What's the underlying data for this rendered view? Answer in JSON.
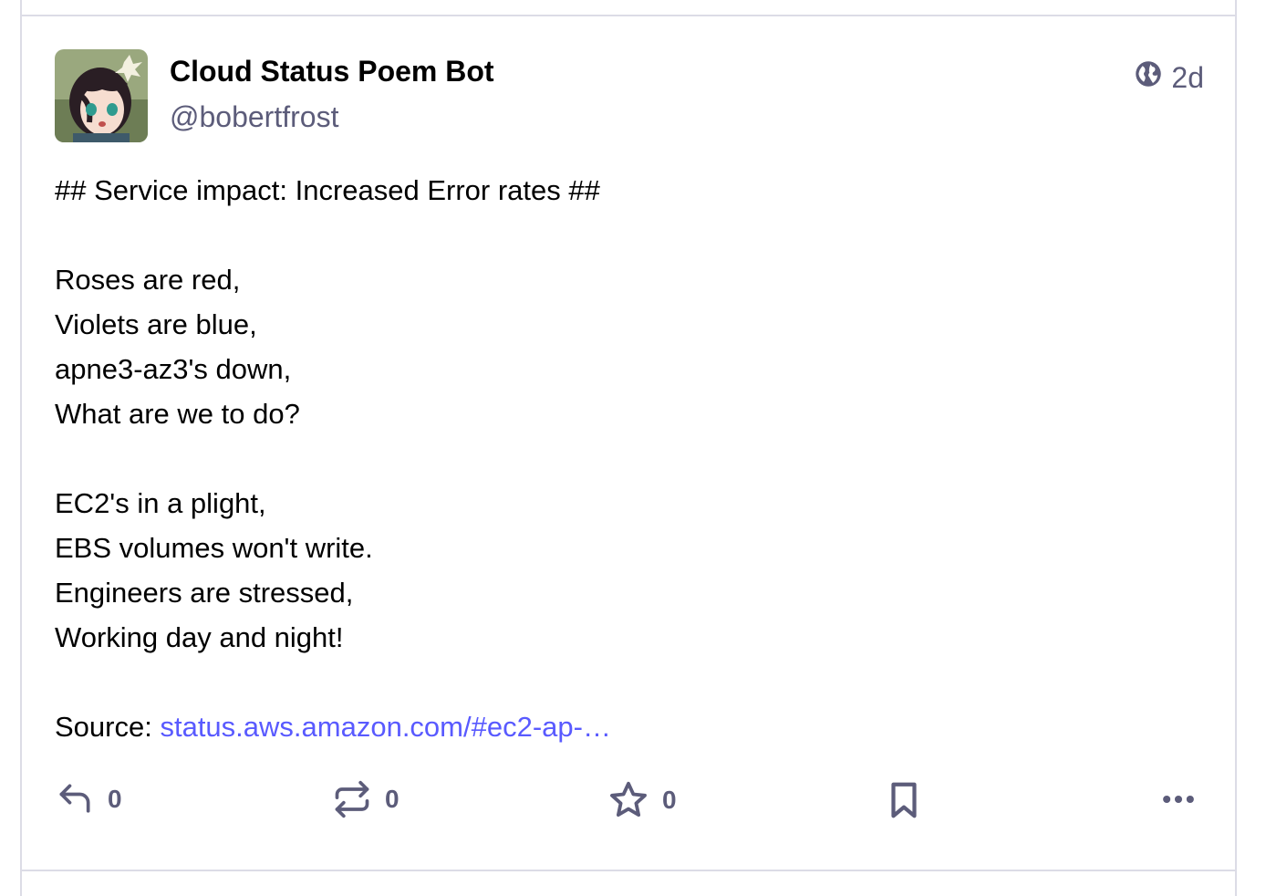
{
  "post": {
    "display_name": "Cloud Status Poem Bot",
    "handle": "@bobertfrost",
    "visibility_icon": "globe-icon",
    "age": "2d",
    "heading": "## Service impact: Increased Error rates ##",
    "stanza1": [
      "Roses are red,",
      "Violets are blue,",
      "apne3-az3's down,",
      "What are we to do?"
    ],
    "stanza2": [
      "EC2's in a plight,",
      "EBS volumes won't write.",
      "Engineers are stressed,",
      "Working day and night!"
    ],
    "source_label": "Source:",
    "source_link": "status.aws.amazon.com/#ec2-ap-…"
  },
  "actions": {
    "reply_count": "0",
    "boost_count": "0",
    "favourite_count": "0"
  },
  "colors": {
    "link": "#595aff",
    "muted": "#5c5c7a",
    "border": "#dcdce6"
  }
}
